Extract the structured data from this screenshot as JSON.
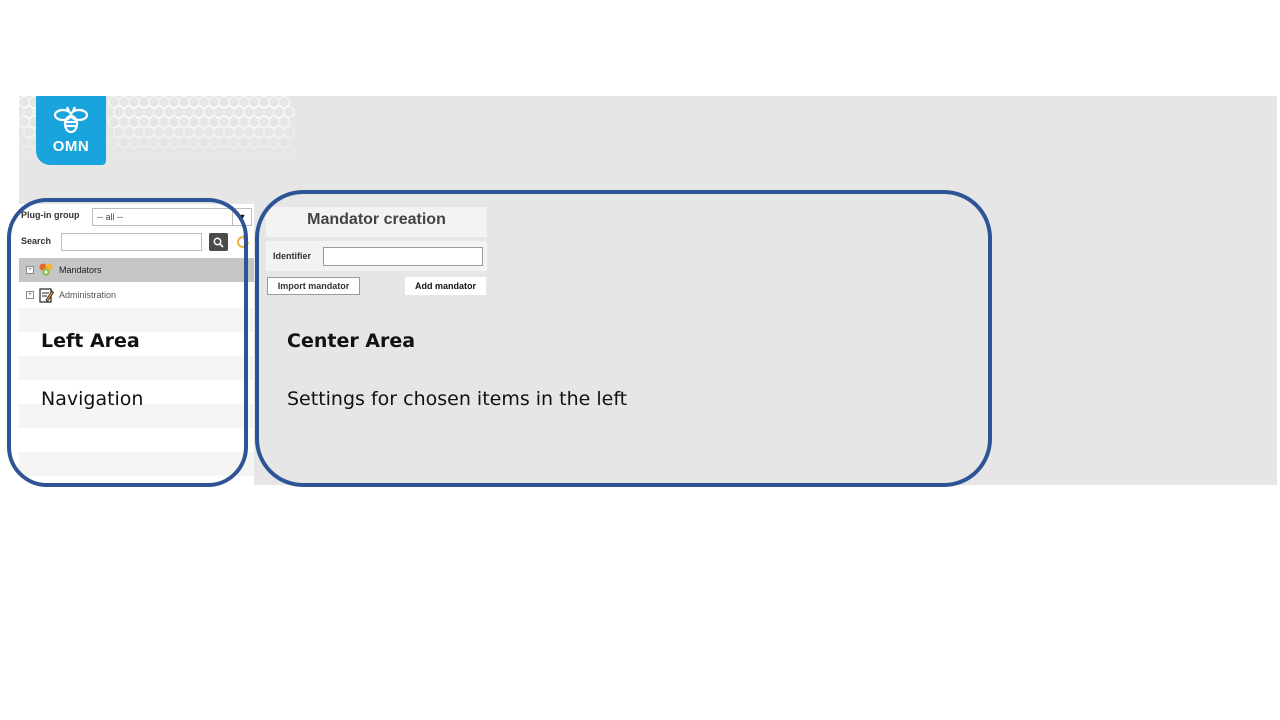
{
  "logo": {
    "text": "OMN",
    "color": "#1aa4dd"
  },
  "left_panel": {
    "plugin_group_label": "Plug-in group",
    "plugin_group_value": "-- all --",
    "search_label": "Search",
    "search_value": "",
    "tree": [
      {
        "label": "Mandators",
        "selected": true,
        "icon": "mandators-icon"
      },
      {
        "label": "Administration",
        "selected": false,
        "icon": "administration-icon"
      }
    ]
  },
  "center": {
    "title": "Mandator creation",
    "identifier_label": "Identifier",
    "identifier_value": "",
    "import_button": "Import mandator",
    "add_button": "Add mandator"
  },
  "annotations": {
    "left_title": "Left Area",
    "left_desc": "Navigation",
    "center_title": "Center Area",
    "center_desc": "Settings for chosen items in the left",
    "frame_color": "#2f5496"
  }
}
